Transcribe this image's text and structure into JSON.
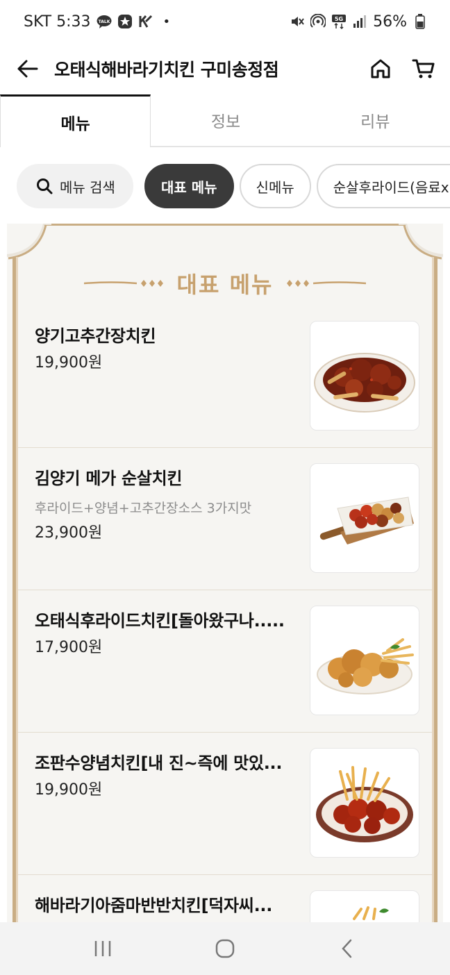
{
  "status_bar": {
    "carrier_time": "SKT 5:33",
    "battery": "56%",
    "left_icons": [
      "talk-icon",
      "star-badge-icon",
      "k-app-icon"
    ],
    "right_icons": [
      "mute-icon",
      "hotspot-icon",
      "5g-icon",
      "signal-icon",
      "battery-icon"
    ]
  },
  "header": {
    "title": "오태식해바라기치킨 구미송정점",
    "back_icon": "back-arrow-icon",
    "home_icon": "home-icon",
    "cart_icon": "cart-icon"
  },
  "tabs": [
    {
      "label": "메뉴",
      "active": true
    },
    {
      "label": "정보",
      "active": false
    },
    {
      "label": "리뷰",
      "active": false
    }
  ],
  "chips": {
    "search_label": "메뉴 검색",
    "items": [
      "대표 메뉴",
      "신메뉴",
      "순살후라이드(음료x,치"
    ]
  },
  "section": {
    "title": "대표 메뉴"
  },
  "menu_items": [
    {
      "name": "양기고추간장치킨",
      "desc": "",
      "price": "19,900원",
      "image": "soy-chili-chicken-image"
    },
    {
      "name": "김양기 메가 순살치킨",
      "desc": "후라이드+양념+고추간장소스 3가지맛",
      "price": "23,900원",
      "image": "boneless-combo-chicken-image"
    },
    {
      "name": "오태식후라이드치킨[돌아왔구나.....",
      "desc": "",
      "price": "17,900원",
      "image": "fried-chicken-image"
    },
    {
      "name": "조판수양념치킨[내 진~즉에 맛있...",
      "desc": "",
      "price": "19,900원",
      "image": "seasoned-chicken-image"
    },
    {
      "name": "해바라기아줌마반반치킨[덕자씨...",
      "desc": "",
      "price": "",
      "image": "half-half-chicken-image"
    }
  ],
  "colors": {
    "accent_gold": "#c7a16e",
    "chip_selected": "#3a3a3a",
    "board_bg": "#f6f5f2"
  },
  "nav_bar": [
    "recent-apps-icon",
    "home-circle-icon",
    "back-chevron-icon"
  ]
}
